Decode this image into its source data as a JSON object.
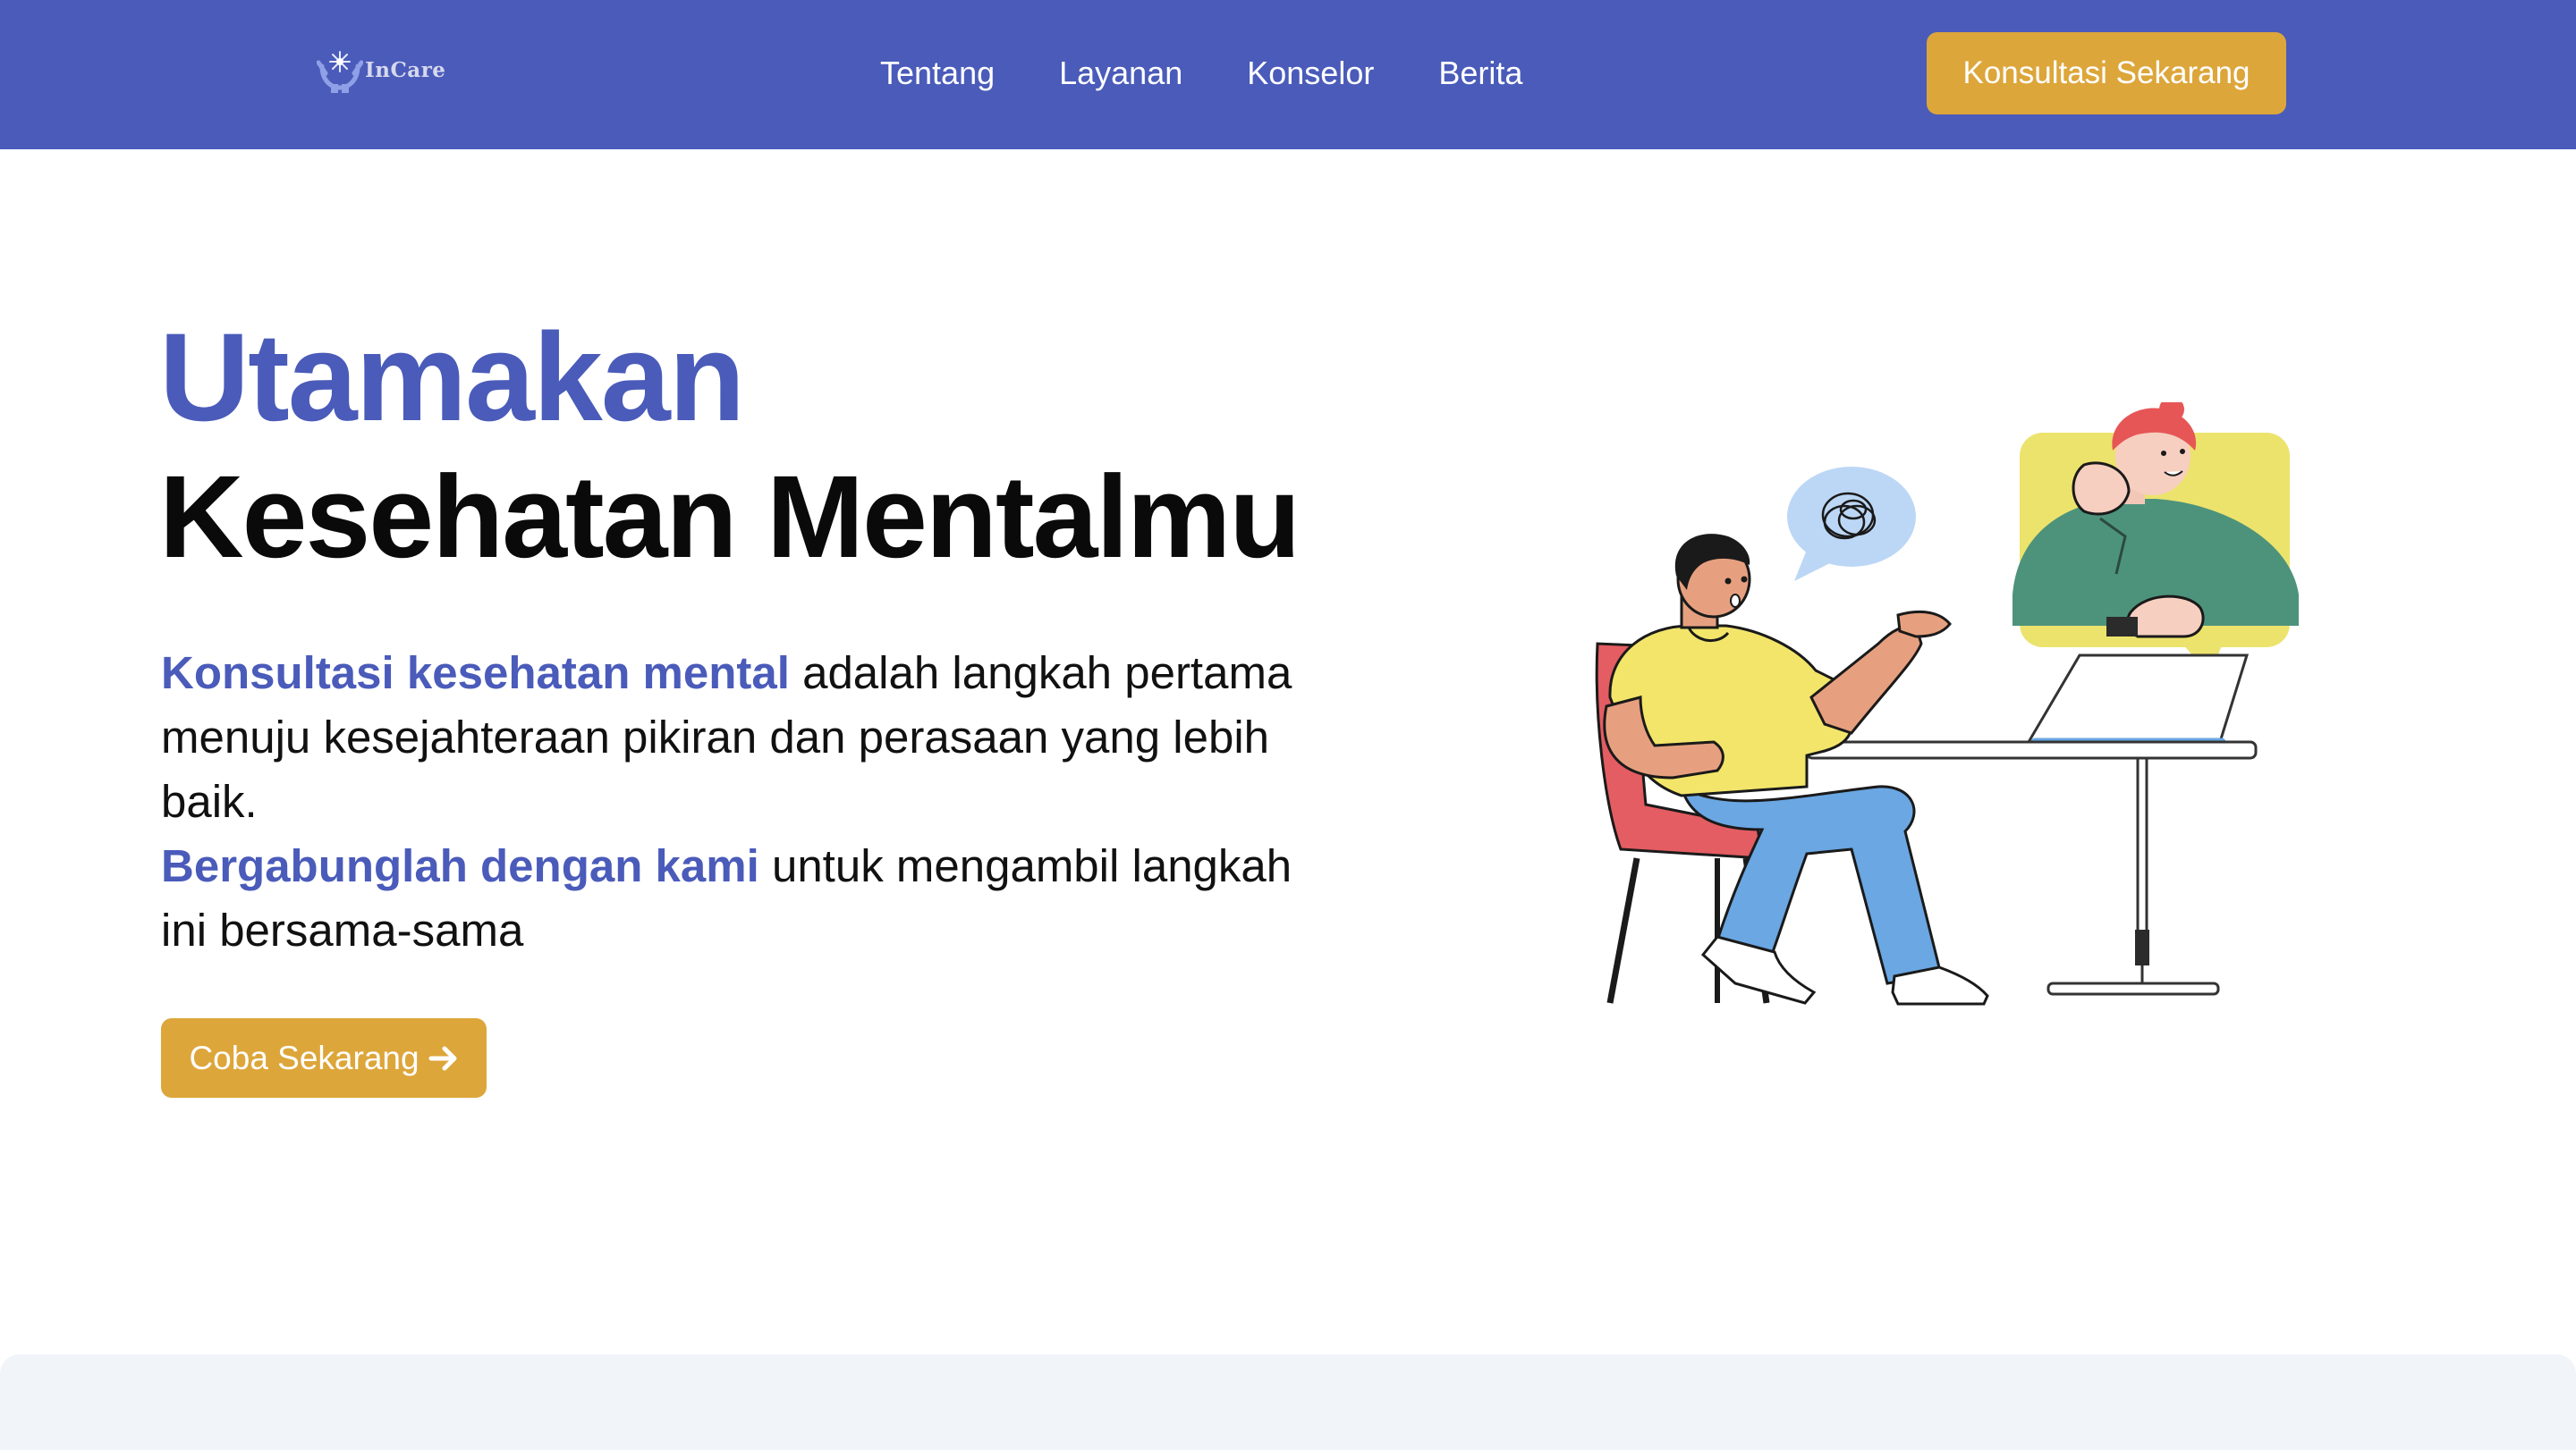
{
  "brand": {
    "logo_text": "InCare",
    "color_primary": "#4a5bba",
    "color_accent": "#dda63a"
  },
  "nav": {
    "links": [
      "Tentang",
      "Layanan",
      "Konselor",
      "Berita"
    ],
    "cta_label": "Konsultasi Sekarang"
  },
  "hero": {
    "title_accent": "Utamakan",
    "title_main": "Kesehatan Mentalmu",
    "desc_highlight_1": "Konsultasi kesehatan mental",
    "desc_text_1": " adalah langkah pertama menuju kesejahteraan pikiran dan perasaan yang lebih baik.",
    "desc_highlight_2": "Bergabunglah dengan kami",
    "desc_text_2": " untuk mengambil langkah ini bersama-sama",
    "button_label": "Coba Sekarang",
    "button_icon": "arrow-right-icon"
  }
}
